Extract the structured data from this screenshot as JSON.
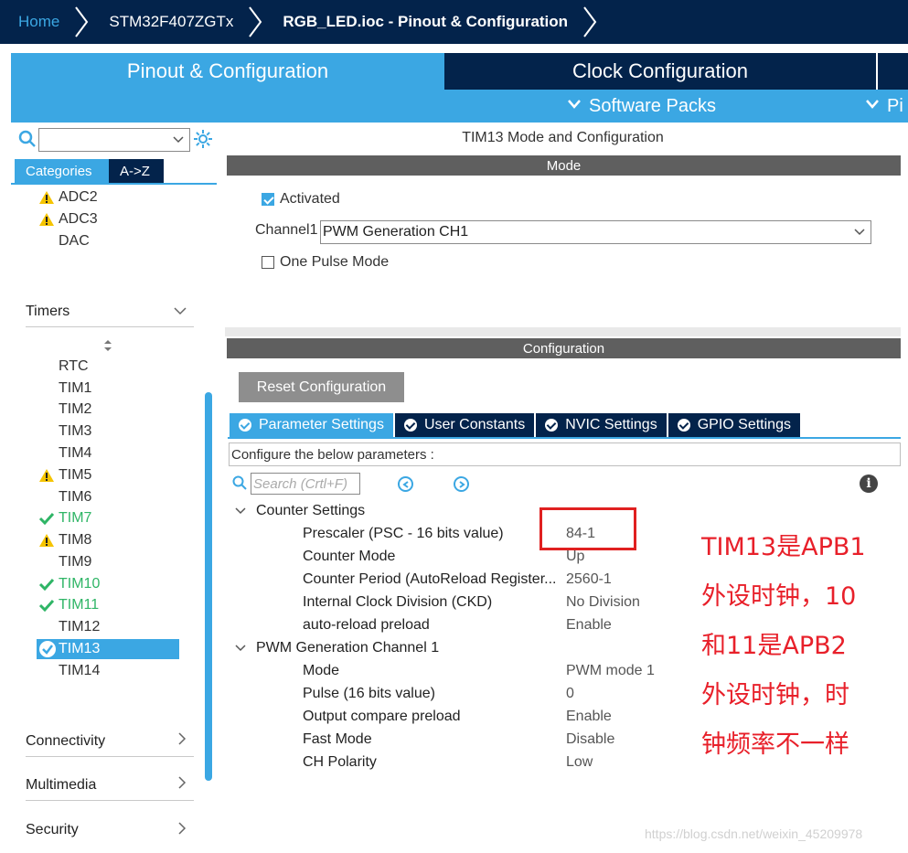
{
  "breadcrumb": {
    "home": "Home",
    "device": "STM32F407ZGTx",
    "current": "RGB_LED.ioc - Pinout & Configuration"
  },
  "top_tabs": {
    "pinout": "Pinout & Configuration",
    "clock": "Clock Configuration",
    "more": ""
  },
  "sub_bar": {
    "software_packs": "Software Packs",
    "pinout_truncated": "Pi"
  },
  "left": {
    "categories_tab": "Categories",
    "az_tab": "A->Z",
    "analog_items": [
      {
        "label": "ADC2",
        "warning": true
      },
      {
        "label": "ADC3",
        "warning": true
      },
      {
        "label": "DAC",
        "warning": false
      }
    ],
    "timers_header": "Timers",
    "timer_items": [
      {
        "label": "RTC",
        "status": "none"
      },
      {
        "label": "TIM1",
        "status": "none"
      },
      {
        "label": "TIM2",
        "status": "none"
      },
      {
        "label": "TIM3",
        "status": "none"
      },
      {
        "label": "TIM4",
        "status": "none"
      },
      {
        "label": "TIM5",
        "status": "warning"
      },
      {
        "label": "TIM6",
        "status": "none"
      },
      {
        "label": "TIM7",
        "status": "ok"
      },
      {
        "label": "TIM8",
        "status": "warning"
      },
      {
        "label": "TIM9",
        "status": "none"
      },
      {
        "label": "TIM10",
        "status": "ok"
      },
      {
        "label": "TIM11",
        "status": "ok"
      },
      {
        "label": "TIM12",
        "status": "none"
      },
      {
        "label": "TIM13",
        "status": "selected"
      },
      {
        "label": "TIM14",
        "status": "none"
      }
    ],
    "connectivity_header": "Connectivity",
    "multimedia_header": "Multimedia",
    "security_header": "Security"
  },
  "right": {
    "title": "TIM13 Mode and Configuration",
    "mode_bar": "Mode",
    "activated_label": "Activated",
    "channel1_label": "Channel1",
    "channel1_value": "PWM Generation CH1",
    "one_pulse_label": "One Pulse Mode",
    "config_bar": "Configuration",
    "reset_button": "Reset Configuration",
    "tabs": [
      "Parameter Settings",
      "User Constants",
      "NVIC Settings",
      "GPIO Settings"
    ],
    "config_desc": "Configure the below parameters :",
    "search_placeholder": "Search (Crtl+F)",
    "info_glyph": "i",
    "counter_group": "Counter Settings",
    "counter_params": [
      {
        "name": "Prescaler (PSC - 16 bits value)",
        "value": "84-1"
      },
      {
        "name": "Counter Mode",
        "value": "Up"
      },
      {
        "name": "Counter Period (AutoReload Register...",
        "value": "2560-1"
      },
      {
        "name": "Internal Clock Division (CKD)",
        "value": "No Division"
      },
      {
        "name": "auto-reload preload",
        "value": "Enable"
      }
    ],
    "pwm_group": "PWM Generation Channel 1",
    "pwm_params": [
      {
        "name": "Mode",
        "value": "PWM mode 1"
      },
      {
        "name": "Pulse (16 bits value)",
        "value": "0"
      },
      {
        "name": "Output compare preload",
        "value": "Enable"
      },
      {
        "name": "Fast Mode",
        "value": "Disable"
      },
      {
        "name": "CH Polarity",
        "value": "Low"
      }
    ]
  },
  "annotation": {
    "lines": [
      "TIM13是APB1",
      "外设时钟，10",
      "和11是APB2",
      "外设时钟，时",
      "钟频率不一样"
    ]
  },
  "watermark": "https://blog.csdn.net/weixin_45209978",
  "colors": {
    "navy": "#03234b",
    "accent": "#3ba7e3",
    "ok_green": "#2fb566",
    "warning_yellow": "#f5c400",
    "annotation_red": "#e8202a"
  }
}
